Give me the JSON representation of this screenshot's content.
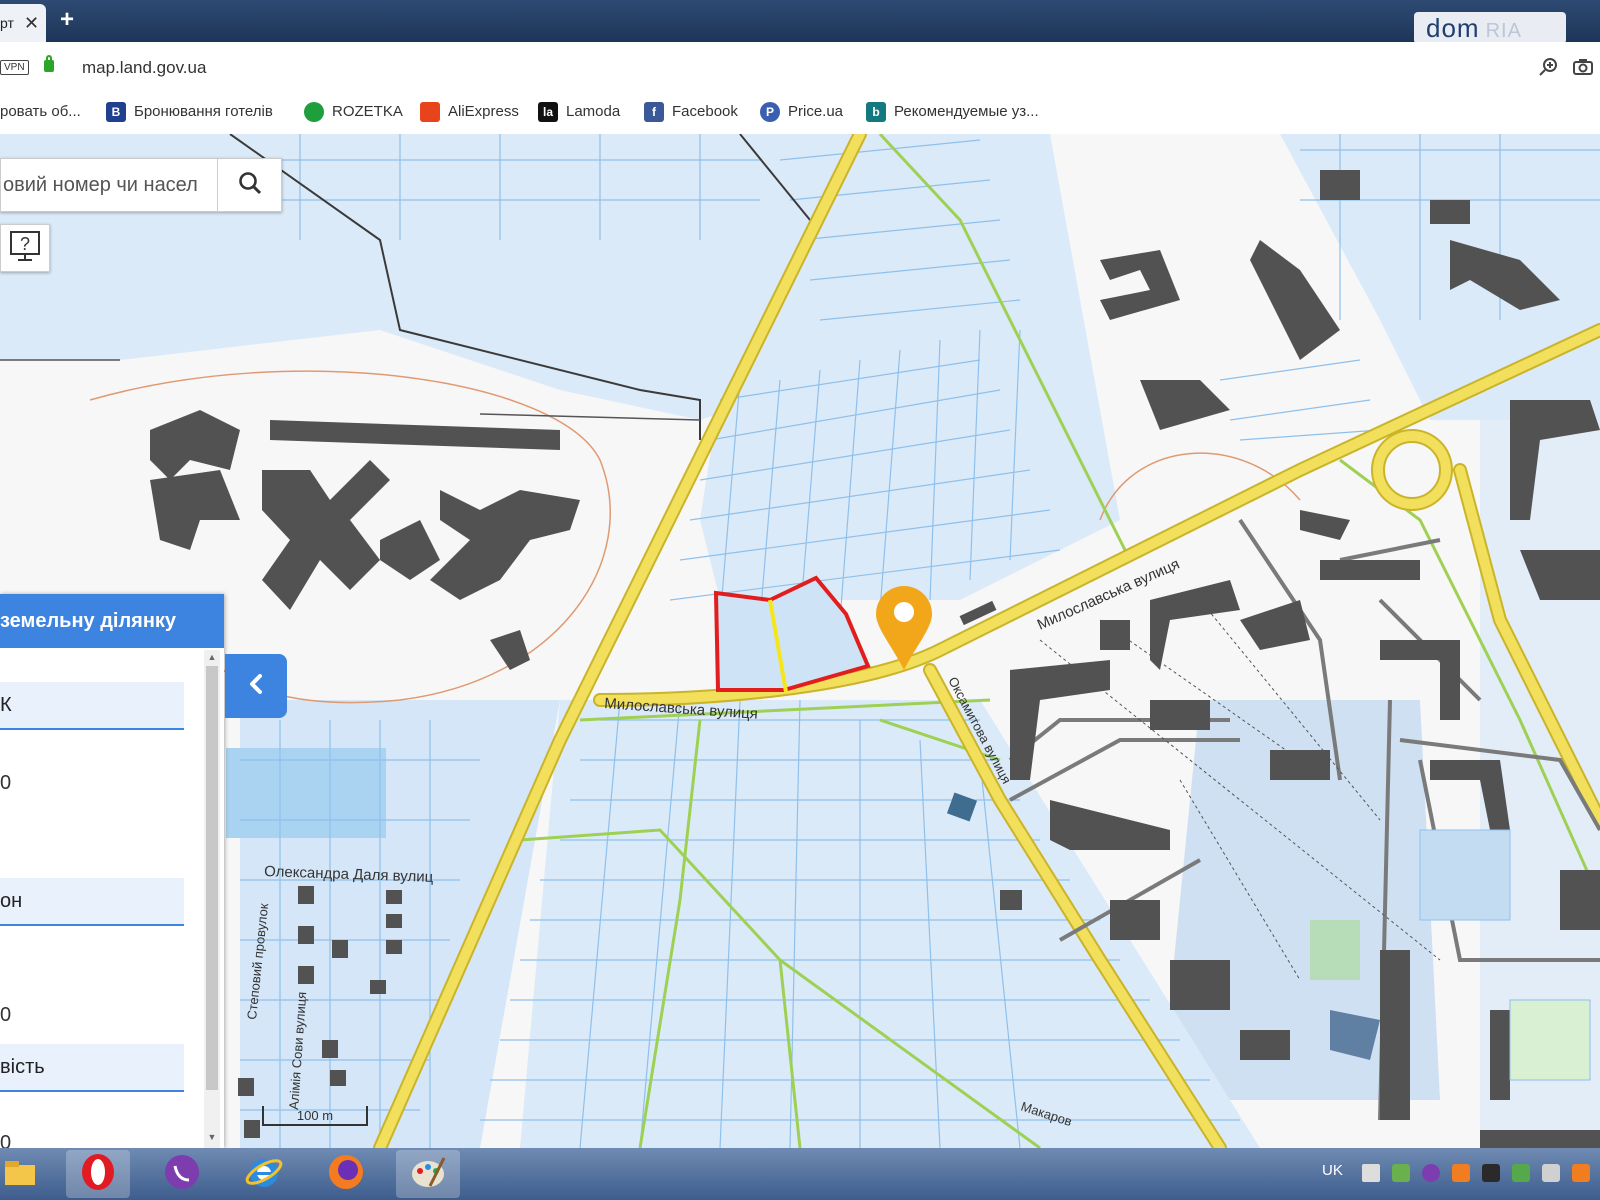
{
  "browser": {
    "tab_title": "рт",
    "tab_close": "✕",
    "new_tab": "+",
    "vpn_label": "VPN",
    "url": "map.land.gov.ua"
  },
  "brand_logo": {
    "text": "dom",
    "suffix": "RIA"
  },
  "bookmarks": [
    {
      "label": "ровать об...",
      "icon": "bookmark-page-icon",
      "color": "#ffffff"
    },
    {
      "label": "Бронювання готелів",
      "icon": "booking-icon",
      "glyph": "B",
      "color": "#1f3f8f"
    },
    {
      "label": "ROZETKA",
      "icon": "rozetka-icon",
      "glyph": "",
      "color": "#1e9e3c"
    },
    {
      "label": "AliExpress",
      "icon": "aliexpress-icon",
      "glyph": "",
      "color": "#e8441b"
    },
    {
      "label": "Lamoda",
      "icon": "lamoda-icon",
      "glyph": "la",
      "color": "#111111"
    },
    {
      "label": "Facebook",
      "icon": "facebook-icon",
      "glyph": "f",
      "color": "#3b5998"
    },
    {
      "label": "Price.ua",
      "icon": "price-icon",
      "glyph": "P",
      "color": "#3a5fb0"
    },
    {
      "label": "Рекомендуемые уз...",
      "icon": "bing-icon",
      "glyph": "b",
      "color": "#14797e"
    }
  ],
  "search": {
    "placeholder": "овий номер чи насел"
  },
  "panel": {
    "header": "земельну ділянку",
    "fields": [
      "К",
      "он",
      "вість"
    ],
    "values": [
      "0",
      "0",
      "0"
    ]
  },
  "map": {
    "street_labels": [
      "Милославська вулиця",
      "Милославська вулиця",
      "Олександра Даля вулиц",
      "Степовий провулок",
      "Алімія Сови вулиця",
      "Макаров",
      "Оксамитова вулиця"
    ],
    "scale_label": "100 m",
    "colors": {
      "parcel_fill": "#cfe3f7",
      "parcel_line": "#8fc0ec",
      "road": "#f2df5c",
      "building": "#525252",
      "selected": "#e11d1d",
      "marker": "#f2a71b"
    }
  },
  "taskbar": {
    "apps": [
      "explorer-icon",
      "opera-icon",
      "viber-icon",
      "ie-icon",
      "firefox-icon",
      "paint-icon"
    ],
    "lang": "UK"
  }
}
